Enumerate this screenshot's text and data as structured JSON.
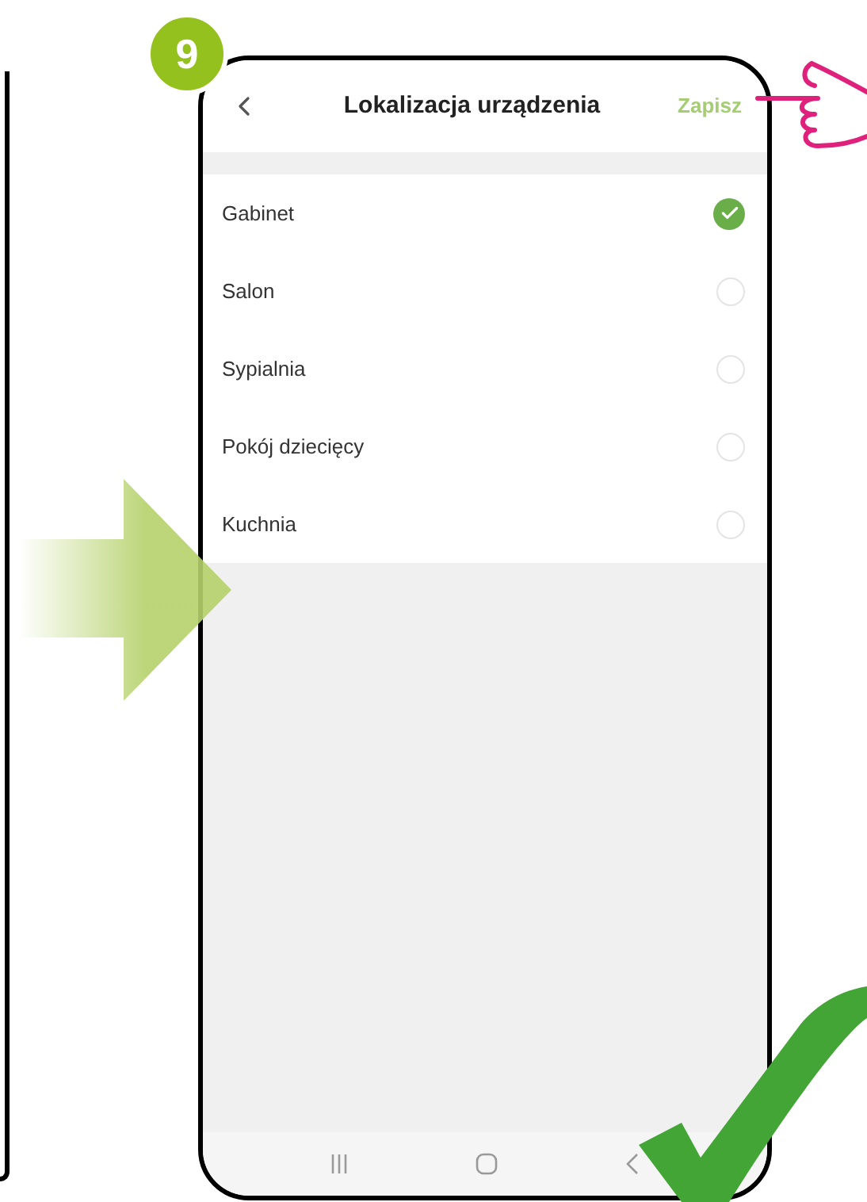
{
  "step_badge": "9",
  "header": {
    "title": "Lokalizacja urządzenia",
    "save": "Zapisz"
  },
  "rooms": [
    {
      "label": "Gabinet",
      "selected": true
    },
    {
      "label": "Salon",
      "selected": false
    },
    {
      "label": "Sypialnia",
      "selected": false
    },
    {
      "label": "Pokój dziecięcy",
      "selected": false
    },
    {
      "label": "Kuchnia",
      "selected": false
    }
  ]
}
